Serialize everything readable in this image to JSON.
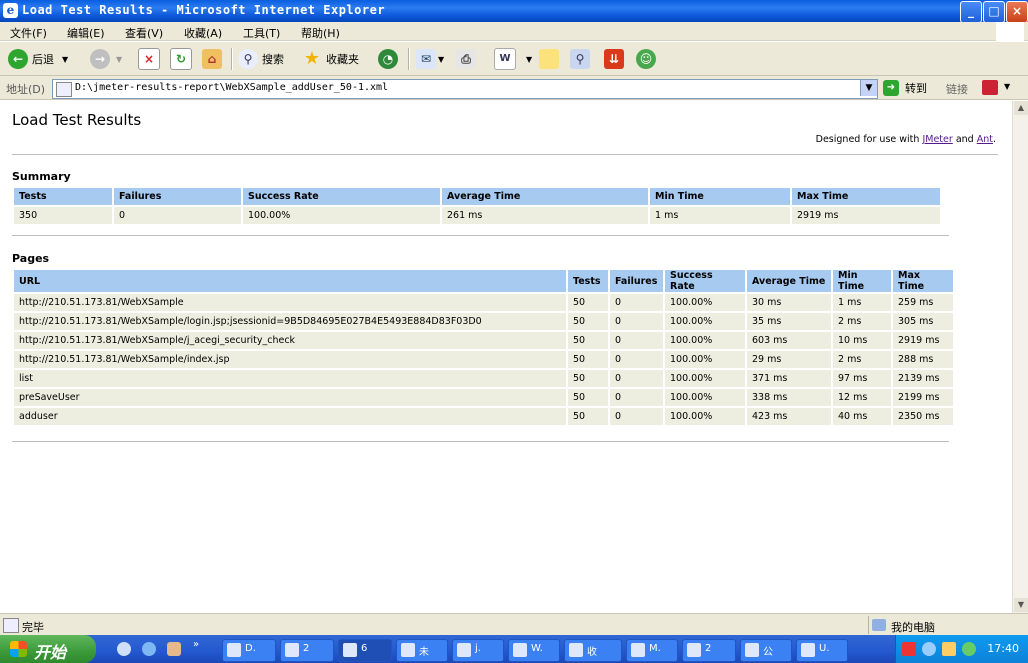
{
  "window": {
    "title": "Load Test Results - Microsoft Internet Explorer",
    "app_icon": "e",
    "controls": {
      "minimize": "_",
      "maximize": "□",
      "close": "×"
    }
  },
  "menu": [
    "文件(F)",
    "编辑(E)",
    "查看(V)",
    "收藏(A)",
    "工具(T)",
    "帮助(H)"
  ],
  "toolbar": {
    "back_label": "后退",
    "search_label": "搜索",
    "favorites_label": "收藏夹"
  },
  "address": {
    "label": "地址(D)",
    "url": "D:\\jmeter-results-report\\WebXSample_addUser_50-1.xml",
    "go_label": "转到",
    "links_label": "链接"
  },
  "page": {
    "title": "Load Test Results",
    "designed_prefix": "Designed for use with",
    "jmeter_link": "JMeter",
    "and_text": "and",
    "ant_link": "Ant",
    "period": ".",
    "summary_heading": "Summary",
    "summary": {
      "headers": [
        "Tests",
        "Failures",
        "Success Rate",
        "Average Time",
        "Min Time",
        "Max Time"
      ],
      "row": [
        "350",
        "0",
        "100.00%",
        "261 ms",
        "1 ms",
        "2919 ms"
      ]
    },
    "pages_heading": "Pages",
    "pages": {
      "headers": [
        "URL",
        "Tests",
        "Failures",
        "Success Rate",
        "Average Time",
        "Min Time",
        "Max Time"
      ],
      "rows": [
        [
          "http://210.51.173.81/WebXSample",
          "50",
          "0",
          "100.00%",
          "30 ms",
          "1 ms",
          "259 ms"
        ],
        [
          "http://210.51.173.81/WebXSample/login.jsp;jsessionid=9B5D84695E027B4E5493E884D83F03D0",
          "50",
          "0",
          "100.00%",
          "35 ms",
          "2 ms",
          "305 ms"
        ],
        [
          "http://210.51.173.81/WebXSample/j_acegi_security_check",
          "50",
          "0",
          "100.00%",
          "603 ms",
          "10 ms",
          "2919 ms"
        ],
        [
          "http://210.51.173.81/WebXSample/index.jsp",
          "50",
          "0",
          "100.00%",
          "29 ms",
          "2 ms",
          "288 ms"
        ],
        [
          "list",
          "50",
          "0",
          "100.00%",
          "371 ms",
          "97 ms",
          "2139 ms"
        ],
        [
          "preSaveUser",
          "50",
          "0",
          "100.00%",
          "338 ms",
          "12 ms",
          "2199 ms"
        ],
        [
          "adduser",
          "50",
          "0",
          "100.00%",
          "423 ms",
          "40 ms",
          "2350 ms"
        ]
      ]
    }
  },
  "status": {
    "text": "完毕",
    "zone": "我的电脑"
  },
  "taskbar": {
    "start": "开始",
    "tasks": [
      "D.",
      "2",
      "6",
      "未",
      "j.",
      "W.",
      "收",
      "M.",
      "2",
      "公",
      "U."
    ],
    "clock": "17:40"
  },
  "colors": {
    "header_bg": "#a6caf0",
    "row_bg": "#eeeee0",
    "link": "#551a8b"
  }
}
